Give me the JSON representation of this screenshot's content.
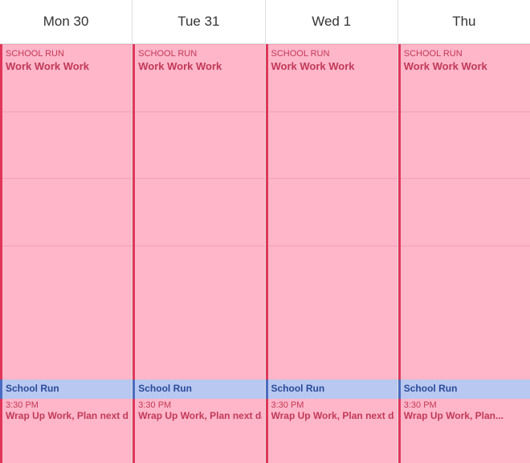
{
  "header": {
    "days": [
      {
        "label": "Mon 30"
      },
      {
        "label": "Tue 31"
      },
      {
        "label": "Wed 1"
      },
      {
        "label": "Thu"
      }
    ]
  },
  "columns": [
    {
      "id": "mon",
      "work_event": {
        "cut_label": "SCHOOL RUN",
        "title": "Work Work Work"
      },
      "school_run": {
        "title": "School Run"
      },
      "wrap_up": {
        "time": "3:30 PM",
        "title": "Wrap Up Work, Plan next dat"
      }
    },
    {
      "id": "tue",
      "work_event": {
        "cut_label": "SCHOOL RUN",
        "title": "Work Work Work"
      },
      "school_run": {
        "title": "School Run"
      },
      "wrap_up": {
        "time": "3:30 PM",
        "title": "Wrap Up Work, Plan next dat"
      }
    },
    {
      "id": "wed",
      "work_event": {
        "cut_label": "SCHOOL RUN",
        "title": "Work Work Work"
      },
      "school_run": {
        "title": "School Run"
      },
      "wrap_up": {
        "time": "3:30 PM",
        "title": "Wrap Up Work, Plan next dat"
      }
    },
    {
      "id": "thu",
      "work_event": {
        "cut_label": "SCHOOL RUN",
        "title": "Work Work Work"
      },
      "school_run": {
        "title": "School Run"
      },
      "wrap_up": {
        "time": "3:30 PM",
        "title": "Wrap Up Work, Plan..."
      }
    }
  ],
  "colors": {
    "work_bg": "#ffb6c8",
    "work_border": "#e0365a",
    "work_text": "#c0395a",
    "school_bg": "#b8c8f0",
    "school_border": "#4a6cc0",
    "school_text": "#2a4a9a"
  }
}
